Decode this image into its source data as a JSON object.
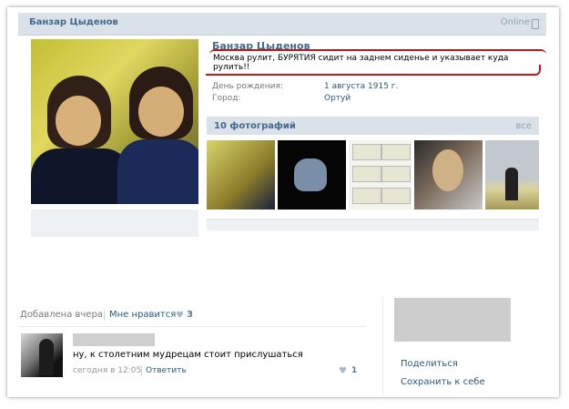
{
  "profile": {
    "header_name": "Банзар Цыденов",
    "online": "Online",
    "name": "Банзар Цыденов",
    "status": "Москва рулит, БУРЯТИЯ сидит на заднем сиденье и указывает куда рулить!!",
    "birthday_label": "День рождения:",
    "birthday_value": "1 августа 1915 г.",
    "city_label": "Город:",
    "city_value": "Ортуй",
    "photos_title": "10 фотографий",
    "photos_all": "все"
  },
  "post": {
    "added": "Добавлена вчера",
    "like_label": "Мне нравится",
    "like_count": "3"
  },
  "comment": {
    "text": "ну, к столетним мудрецам стоит прислушаться",
    "date": "сегодня в 12:05",
    "reply": "Ответить",
    "likes": "1"
  },
  "sidebar": {
    "share": "Поделиться",
    "save": "Сохранить к себе"
  },
  "colors": {
    "link": "#2b587a",
    "header_bg": "#dae1e8",
    "highlight": "#c4151b"
  }
}
